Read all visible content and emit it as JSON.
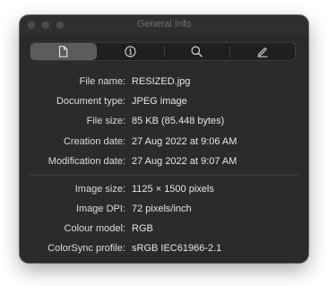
{
  "window": {
    "title": "General Info"
  },
  "toolbar": {
    "tabs": [
      {
        "name": "general",
        "icon": "document-icon",
        "active": true
      },
      {
        "name": "info",
        "icon": "info-icon",
        "active": false
      },
      {
        "name": "search",
        "icon": "magnifier-icon",
        "active": false
      },
      {
        "name": "edit",
        "icon": "pencil-icon",
        "active": false
      }
    ]
  },
  "file_info": [
    {
      "label": "File name:",
      "value": "RESIZED.jpg"
    },
    {
      "label": "Document type:",
      "value": "JPEG image"
    },
    {
      "label": "File size:",
      "value": "85 KB (85.448 bytes)"
    },
    {
      "label": "Creation date:",
      "value": "27 Aug 2022 at 9:06 AM"
    },
    {
      "label": "Modification date:",
      "value": "27 Aug 2022 at 9:07 AM"
    }
  ],
  "image_info": [
    {
      "label": "Image size:",
      "value": "1125 × 1500 pixels"
    },
    {
      "label": "Image DPI:",
      "value": "72 pixels/inch"
    },
    {
      "label": "Colour model:",
      "value": "RGB"
    },
    {
      "label": "ColorSync profile:",
      "value": "sRGB IEC61966-2.1"
    }
  ],
  "colors": {
    "window_bg": "#2b2b2b",
    "text": "#dcdcdc",
    "active_segment": "#5c5c5c"
  }
}
